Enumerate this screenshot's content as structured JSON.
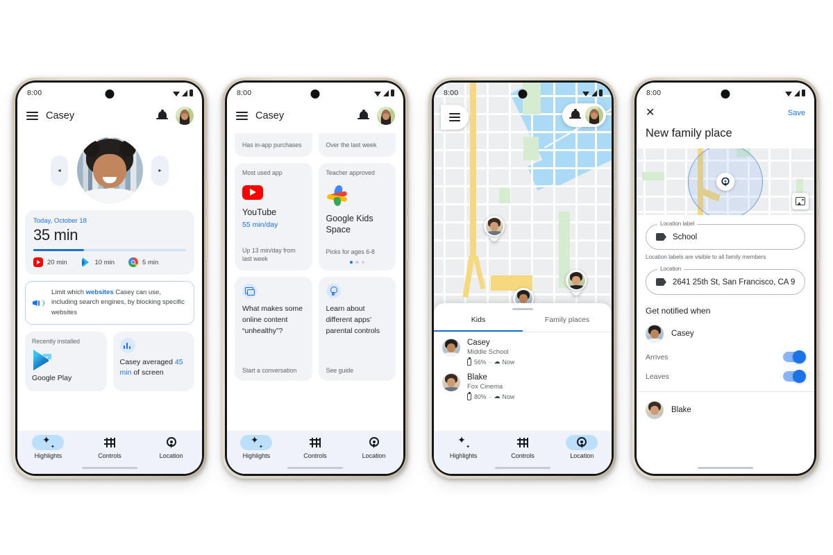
{
  "meta": {
    "status_time": "8:00"
  },
  "phone1": {
    "appbar": {
      "title": "Casey",
      "menu_icon": "hamburger-icon",
      "bell_icon": "bell-icon",
      "avatar_icon": "parent-avatar"
    },
    "carousel": {
      "prev": "◂",
      "next": "▸",
      "child_photo": "casey-photo"
    },
    "usage": {
      "date": "Today, October 18",
      "total": "35 min",
      "progress_pct": 33,
      "apps": [
        {
          "name": "YouTube",
          "icon": "youtube-icon",
          "time": "20 min"
        },
        {
          "name": "Google Play",
          "icon": "play-store-icon",
          "time": "10 min"
        },
        {
          "name": "Chrome",
          "icon": "chrome-icon",
          "time": "5 min"
        }
      ]
    },
    "tip": {
      "icon": "megaphone-icon",
      "pre": "Limit which ",
      "link": "websites",
      "post": " Casey can use, including search engines, by blocking specific websites"
    },
    "recently_installed": {
      "label": "Recently installed",
      "app_icon": "play-store-icon",
      "app_name": "Google Play"
    },
    "average": {
      "icon": "bar-chart-icon",
      "pre": "Casey averaged ",
      "highlight": "45 min",
      "post": " of screen"
    },
    "nav": [
      {
        "label": "Highlights",
        "icon": "sparkle-icon",
        "active": true
      },
      {
        "label": "Controls",
        "icon": "sliders-icon",
        "active": false
      },
      {
        "label": "Location",
        "icon": "pin-icon",
        "active": false
      }
    ]
  },
  "phone2": {
    "appbar": {
      "title": "Casey"
    },
    "cut_cards": [
      "Has in-app purchases",
      "Over the last week"
    ],
    "cards": [
      {
        "caption": "Most used app",
        "icon": "youtube-icon",
        "title": "YouTube",
        "sub": "55 min/day",
        "footer": "Up 13 min/day from last week"
      },
      {
        "caption": "Teacher approved",
        "icon": "google-kids-space-icon",
        "title": "Google Kids Space",
        "sub": "",
        "footer": "Picks for ages 6-8"
      }
    ],
    "pager": {
      "count": 3,
      "active": 0
    },
    "tips": [
      {
        "icon": "chat-icon",
        "title": "What makes some online content “unhealthy”?",
        "link": "Start a conversation"
      },
      {
        "icon": "lightbulb-icon",
        "title": "Learn about different apps’ parental controls",
        "link": "See guide"
      }
    ],
    "nav": [
      {
        "label": "Highlights",
        "icon": "sparkle-icon",
        "active": true
      },
      {
        "label": "Controls",
        "icon": "sliders-icon",
        "active": false
      },
      {
        "label": "Location",
        "icon": "pin-icon",
        "active": false
      }
    ]
  },
  "phone3": {
    "menu_icon": "hamburger-icon",
    "bell_icon": "bell-icon",
    "avatar_icon": "parent-avatar",
    "recenter_icon": "my-location-icon",
    "map_pins": [
      "blake-pin",
      "parent-pin",
      "casey-pin"
    ],
    "tabs": [
      {
        "label": "Kids",
        "active": true
      },
      {
        "label": "Family places",
        "active": false
      }
    ],
    "kids": [
      {
        "name": "Casey",
        "place": "Middle School",
        "battery": "56%",
        "sep": "·",
        "signal_icon": "signal-icon",
        "time": "Now"
      },
      {
        "name": "Blake",
        "place": "Fox Cinema",
        "battery": "80%",
        "sep": "·",
        "signal_icon": "signal-icon",
        "time": "Now"
      }
    ],
    "nav": [
      {
        "label": "Highlights",
        "icon": "sparkle-icon",
        "active": false
      },
      {
        "label": "Controls",
        "icon": "sliders-icon",
        "active": false
      },
      {
        "label": "Location",
        "icon": "pin-icon",
        "active": true
      }
    ]
  },
  "phone4": {
    "close_icon": "close-icon",
    "save_label": "Save",
    "title": "New family place",
    "map": {
      "pin_icon": "place-pin-icon",
      "photo_button_icon": "image-icon"
    },
    "label_field": {
      "legend": "Location label",
      "value": "School",
      "icon": "tag-icon"
    },
    "label_help": "Location labels are visible to all family members",
    "location_field": {
      "legend": "Location",
      "value": "2641 25th St, San Francisco, CA 9...",
      "icon": "tag-icon"
    },
    "notify_title": "Get notified when",
    "people": [
      {
        "name": "Casey",
        "toggles": [
          {
            "label": "Arrives",
            "on": true
          },
          {
            "label": "Leaves",
            "on": true
          }
        ]
      },
      {
        "name": "Blake",
        "toggles": []
      }
    ]
  },
  "colors": {
    "accent_blue": "#1a73e8",
    "card_gray": "#f1f3f7",
    "nav_bg": "#eff2fa",
    "active_pill": "#bcdffb",
    "youtube_red": "#ff0000",
    "map_water": "#aadaf5",
    "map_highway": "#f6d97f",
    "map_park": "#d5ecd0"
  }
}
